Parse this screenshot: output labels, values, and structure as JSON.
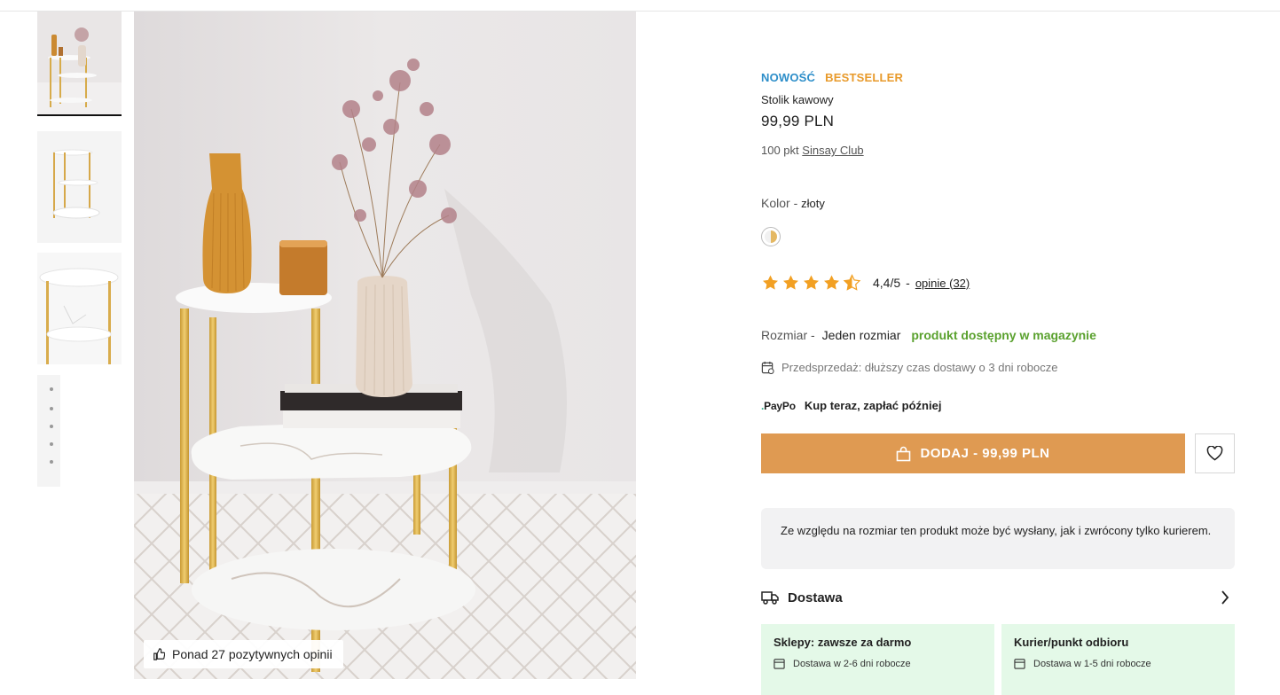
{
  "gallery": {
    "thumbnails": [
      "thumbnail-1",
      "thumbnail-2",
      "thumbnail-3",
      "thumbnail-4"
    ],
    "review_badge": "Ponad 27 pozytywnych opinii"
  },
  "product": {
    "badge_new": "NOWOŚĆ",
    "badge_bestseller": "BESTSELLER",
    "name": "Stolik kawowy",
    "price": "99,99 PLN",
    "club_points": "100 pkt",
    "club_link": "Sinsay Club",
    "color_label": "Kolor -",
    "color_value": "złoty",
    "rating_value": "4,4/5",
    "rating_sep": "-",
    "rating_link": "opinie (32)",
    "rating_fraction": 0.88,
    "size_label": "Rozmiar -",
    "size_value": "Jeden rozmiar",
    "stock_status": "produkt dostępny w magazynie",
    "presale_note": "Przedsprzedaż: dłuższy czas dostawy o 3 dni robocze",
    "paypo_logo_a": "Pay",
    "paypo_logo_b": "Po",
    "paypo_text": "Kup teraz, zapłać później",
    "add_button": "DODAJ - 99,99 PLN",
    "courier_notice": "Ze względu na rozmiar ten produkt może być wysłany, jak i zwrócony tylko kurierem."
  },
  "delivery": {
    "title": "Dostawa",
    "options": [
      {
        "title": "Sklepy: zawsze za darmo",
        "line": "Dostawa w 2-6 dni robocze"
      },
      {
        "title": "Kurier/punkt odbioru",
        "line": "Dostawa w 1-5 dni robocze"
      }
    ]
  },
  "colors": {
    "accent_button": "#df9a52",
    "badge_new": "#2d8ec9",
    "badge_bestseller": "#e89a2b",
    "stock_green": "#5aa12e",
    "star": "#f2a023",
    "ship_box_bg": "#e4f9e8"
  },
  "icons": [
    "like-icon",
    "star-icon",
    "calendar-icon",
    "bag-icon",
    "heart-icon",
    "truck-icon",
    "chevron-right-icon"
  ]
}
